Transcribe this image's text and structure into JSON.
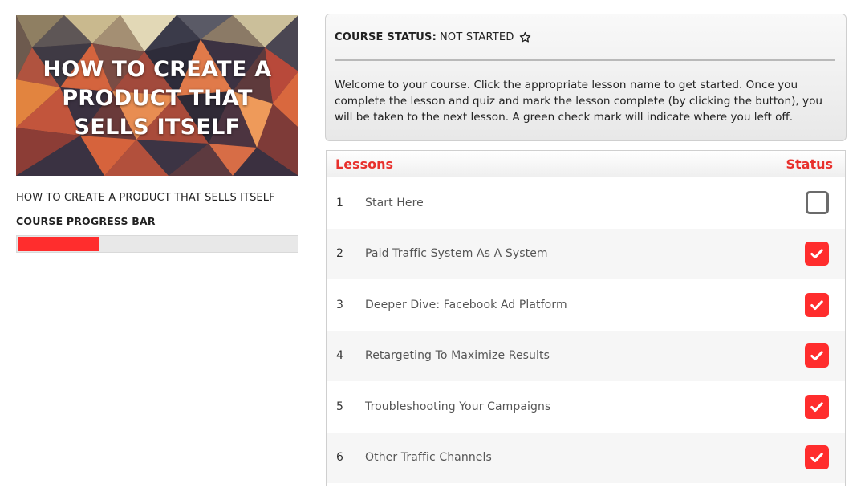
{
  "course": {
    "banner_title": "HOW TO CREATE A PRODUCT THAT SELLS ITSELF",
    "name": "HOW TO CREATE A PRODUCT THAT SELLS ITSELF",
    "progress_label": "COURSE PROGRESS BAR",
    "progress_percent": 29,
    "progress_color": "#ff2d2d"
  },
  "status": {
    "label": "COURSE STATUS:",
    "value": "NOT STARTED",
    "icon": "star-outline-icon",
    "message": "Welcome to your course. Click the appropriate lesson name to get started. Once you complete the lesson and quiz and mark the lesson complete (by clicking the button), you will be taken to the next lesson. A green check mark will indicate where you left off."
  },
  "lessons": {
    "header_left": "Lessons",
    "header_right": "Status",
    "accent_color": "#e8302c",
    "items": [
      {
        "num": "1",
        "title": "Start Here",
        "completed": false
      },
      {
        "num": "2",
        "title": "Paid Traffic System As A System",
        "completed": true
      },
      {
        "num": "3",
        "title": "Deeper Dive: Facebook Ad Platform",
        "completed": true
      },
      {
        "num": "4",
        "title": "Retargeting To Maximize Results",
        "completed": true
      },
      {
        "num": "5",
        "title": "Troubleshooting Your Campaigns",
        "completed": true
      },
      {
        "num": "6",
        "title": "Other Traffic Channels",
        "completed": true
      }
    ]
  }
}
